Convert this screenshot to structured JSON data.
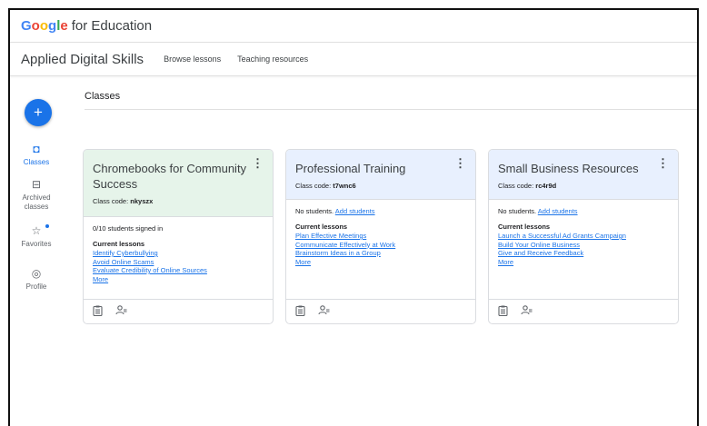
{
  "brand": {
    "google_letters": [
      {
        "ch": "G",
        "color": "#4285F4"
      },
      {
        "ch": "o",
        "color": "#EA4335"
      },
      {
        "ch": "o",
        "color": "#FBBC05"
      },
      {
        "ch": "g",
        "color": "#4285F4"
      },
      {
        "ch": "l",
        "color": "#34A853"
      },
      {
        "ch": "e",
        "color": "#EA4335"
      }
    ],
    "suffix": "for Education"
  },
  "appbar": {
    "title": "Applied Digital Skills",
    "links": [
      "Browse lessons",
      "Teaching resources"
    ]
  },
  "fab": {
    "label": "+"
  },
  "sidebar": {
    "items": [
      {
        "label": "Classes",
        "icon": "class-icon",
        "glyph": "◘"
      },
      {
        "label": "Archived classes",
        "icon": "archive-icon",
        "glyph": "⊟"
      },
      {
        "label": "Favorites",
        "icon": "star-icon",
        "glyph": "☆"
      },
      {
        "label": "Profile",
        "icon": "profile-icon",
        "glyph": "◎"
      }
    ]
  },
  "page": {
    "heading": "Classes"
  },
  "cards": [
    {
      "title": "Chromebooks for Community Success",
      "code_label": "Class code:",
      "code": "nkyszx",
      "students_text": "0/10 students signed in",
      "add_students": "",
      "lessons_heading": "Current lessons",
      "lessons": [
        "Identify Cyberbullying",
        "Avoid Online Scams",
        "Evaluate Credibility of Online Sources",
        "More"
      ],
      "header_color": "#e6f4ea"
    },
    {
      "title": "Professional Training",
      "code_label": "Class code:",
      "code": "t7wnc6",
      "students_text": "No students.",
      "add_students": "Add students",
      "lessons_heading": "Current lessons",
      "lessons": [
        "Plan Effective Meetings",
        "Communicate Effectively at Work",
        "Brainstorm Ideas in a Group",
        "More"
      ],
      "header_color": "#e8f0fe"
    },
    {
      "title": "Small Business Resources",
      "code_label": "Class code:",
      "code": "rc4r9d",
      "students_text": "No students.",
      "add_students": "Add students",
      "lessons_heading": "Current lessons",
      "lessons": [
        "Launch a Successful Ad Grants Campaign",
        "Build Your Online Business",
        "Give and Receive Feedback",
        "More"
      ],
      "header_color": "#e8f0fe"
    }
  ],
  "card_footer_icons": [
    "clipboard-icon",
    "manage-students-icon"
  ],
  "card_menu_glyph": "⋮"
}
